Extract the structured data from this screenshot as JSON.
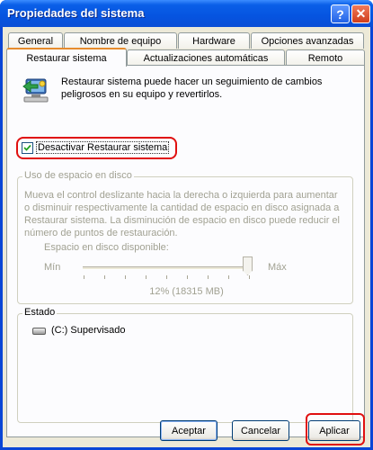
{
  "window": {
    "title": "Propiedades del sistema",
    "help_glyph": "?",
    "close_glyph": "✕"
  },
  "tabs": {
    "row1": [
      "General",
      "Nombre de equipo",
      "Hardware",
      "Opciones avanzadas"
    ],
    "row2": [
      "Restaurar sistema",
      "Actualizaciones automáticas",
      "Remoto"
    ],
    "active": "Restaurar sistema"
  },
  "restore": {
    "icon": "system-restore-icon",
    "intro": "Restaurar sistema puede hacer un seguimiento de cambios peligrosos en su equipo y revertirlos.",
    "disable_checkbox": {
      "label": "Desactivar Restaurar sistema",
      "checked": true
    }
  },
  "disk_usage": {
    "group_title": "Uso de espacio en disco",
    "description": "Mueva el control deslizante hacia la derecha o izquierda para aumentar o disminuir respectivamente la cantidad de espacio en disco asignada a Restaurar sistema. La disminución de espacio en disco puede reducir el número de puntos de restauración.",
    "space_label": "Espacio en disco disponible:",
    "min_label": "Mín",
    "max_label": "Máx",
    "slider_value_pct": 12,
    "value_text": "12% (18315 MB)"
  },
  "status": {
    "group_title": "Estado",
    "drives": [
      {
        "icon": "hard-drive-icon",
        "text": "(C:) Supervisado"
      }
    ]
  },
  "buttons": {
    "accept": "Aceptar",
    "cancel": "Cancelar",
    "apply": "Aplicar"
  },
  "colors": {
    "titlebar": "#0654e0",
    "dialog_bg": "#ece9d8",
    "panel_bg": "#fcfcfe",
    "highlight": "#e01010",
    "disabled_text": "#a1a192"
  }
}
